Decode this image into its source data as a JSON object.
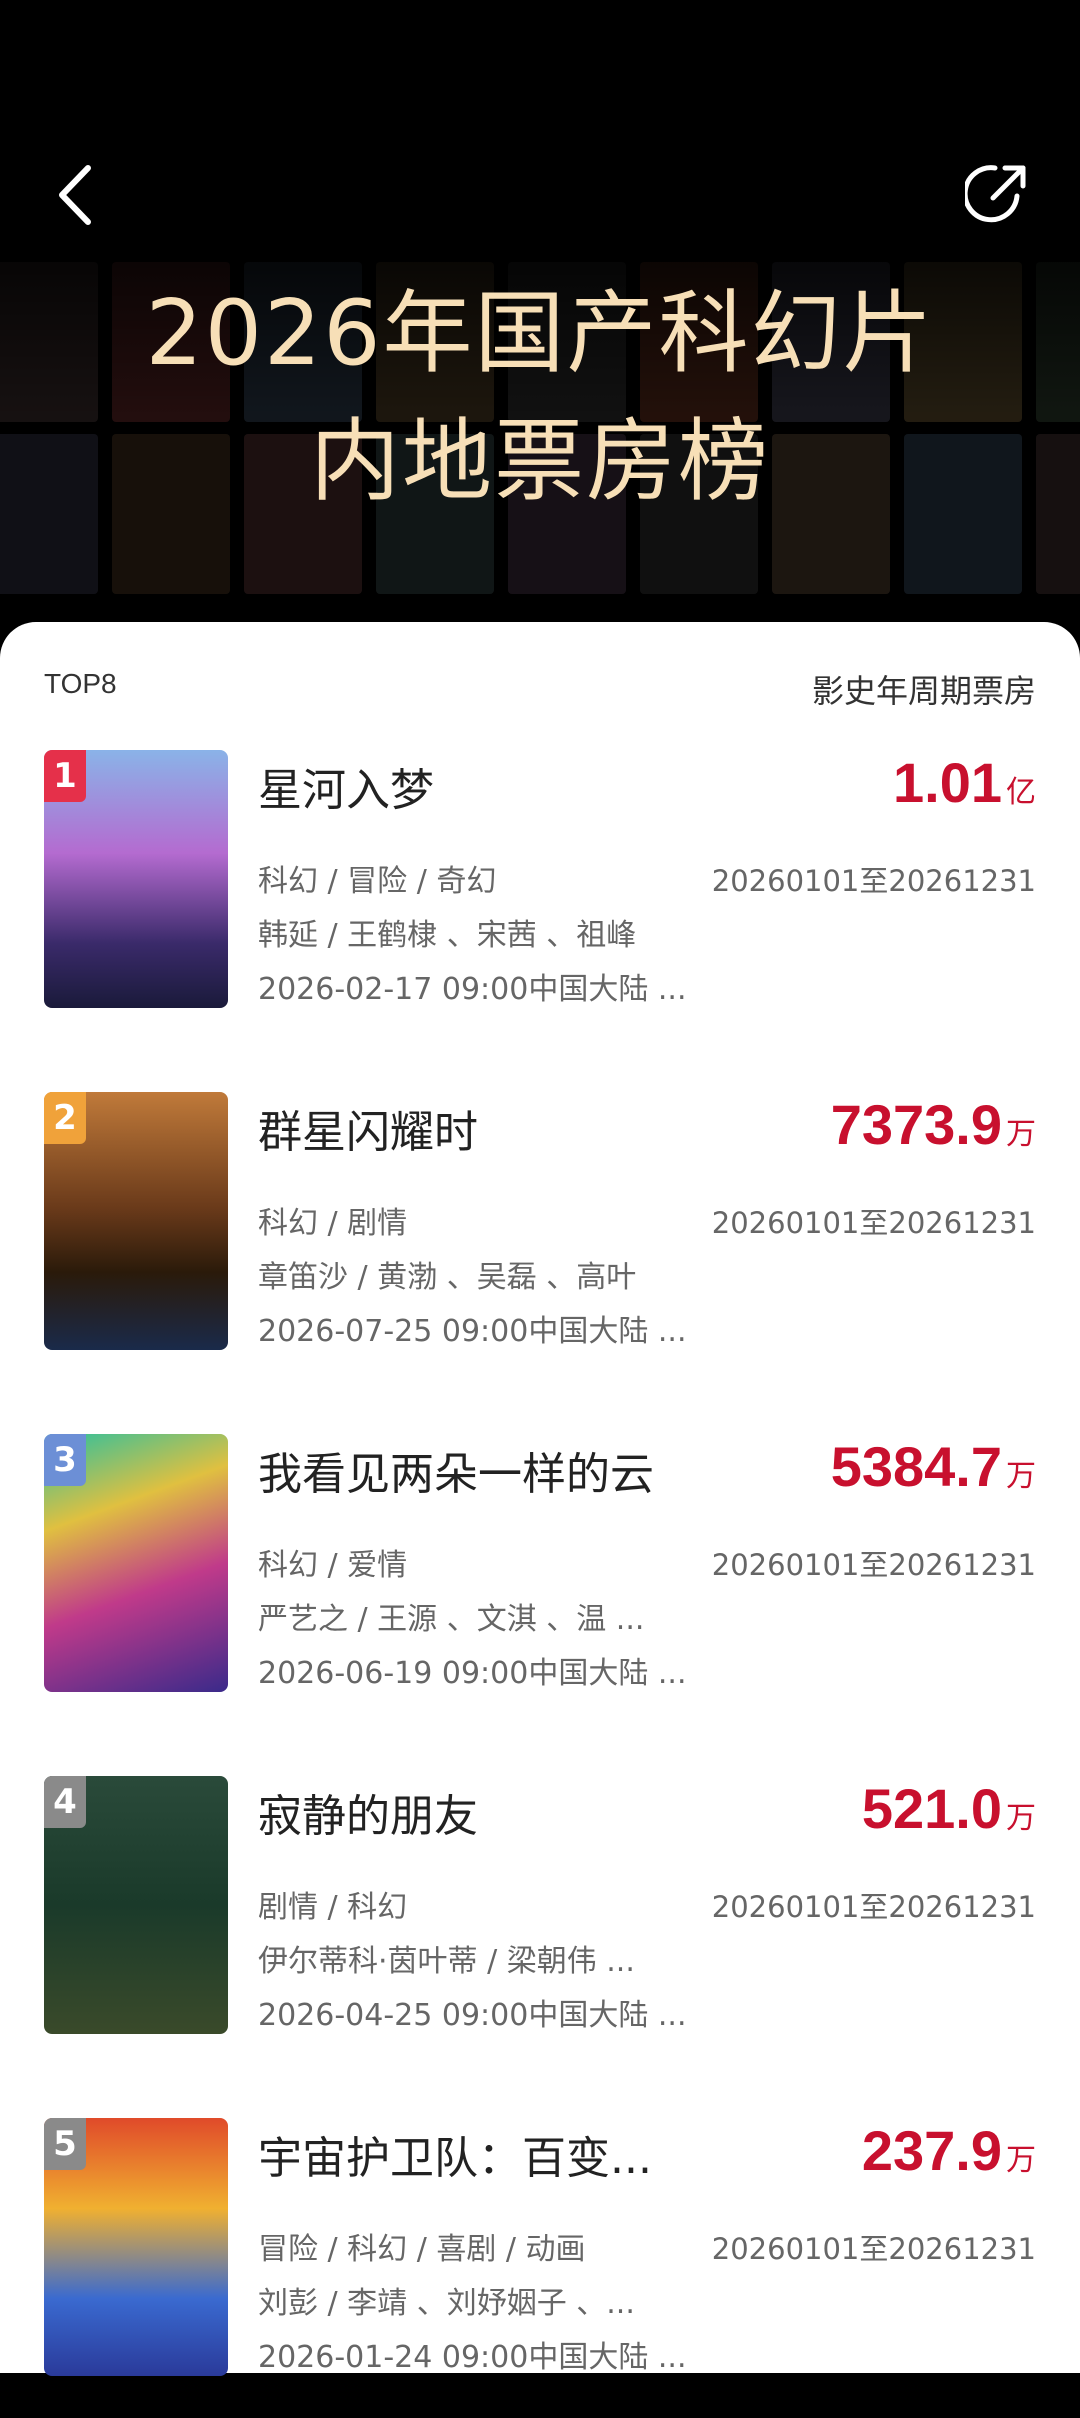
{
  "header": {
    "title_line1": "2026年国产科幻片",
    "title_line2": "内地票房榜"
  },
  "list": {
    "top_label": "TOP8",
    "period_label": "影史年周期票房"
  },
  "colors": {
    "accent_red": "#c8102e",
    "title_gold": "#f7dfb7",
    "rank_1": "#e5304a",
    "rank_2": "#f0a23a",
    "rank_3": "#6c8fd6",
    "rank_4_5": "#8a8a8a"
  },
  "movies": [
    {
      "rank": "1",
      "title": "星河入梦",
      "box_value": "1.01",
      "box_unit": "亿",
      "genres": "科幻 / 冒险 / 奇幻",
      "date_range": "20260101至20261231",
      "cast": "韩延 / 王鹤棣 、宋茜 、祖峰",
      "release": "2026-02-17 09:00中国大陆 ..."
    },
    {
      "rank": "2",
      "title": "群星闪耀时",
      "box_value": "7373.9",
      "box_unit": "万",
      "genres": "科幻 / 剧情",
      "date_range": "20260101至20261231",
      "cast": "章笛沙 / 黄渤 、吴磊 、高叶",
      "release": "2026-07-25 09:00中国大陆 ..."
    },
    {
      "rank": "3",
      "title": "我看见两朵一样的云",
      "box_value": "5384.7",
      "box_unit": "万",
      "genres": "科幻 / 爱情",
      "date_range": "20260101至20261231",
      "cast": "严艺之 / 王源 、文淇 、温 ...",
      "release": "2026-06-19 09:00中国大陆 ..."
    },
    {
      "rank": "4",
      "title": "寂静的朋友",
      "box_value": "521.0",
      "box_unit": "万",
      "genres": "剧情 / 科幻",
      "date_range": "20260101至20261231",
      "cast": "伊尔蒂科·茵叶蒂 / 梁朝伟 ...",
      "release": "2026-04-25 09:00中国大陆 ..."
    },
    {
      "rank": "5",
      "title": "宇宙护卫队：百变...",
      "box_value": "237.9",
      "box_unit": "万",
      "genres": "冒险 / 科幻 / 喜剧 / 动画",
      "date_range": "20260101至20261231",
      "cast": "刘彭 / 李靖 、刘妤姻子 、...",
      "release": "2026-01-24 09:00中国大陆 ..."
    }
  ]
}
